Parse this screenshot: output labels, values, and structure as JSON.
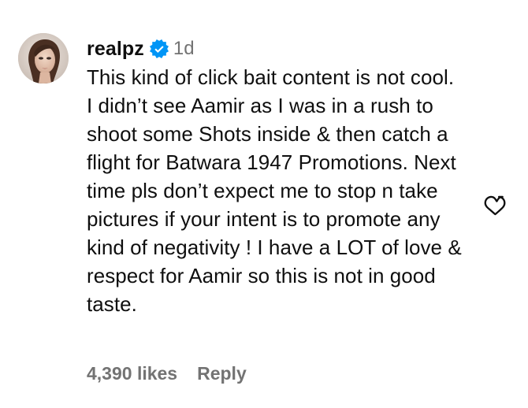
{
  "comment": {
    "username": "realpz",
    "verified": true,
    "timestamp": "1d",
    "text": "This kind of click bait content is not cool. I didn’t see Aamir as I was in a rush to shoot some Shots inside & then catch a flight for Batwara 1947 Promotions. Next time pls don’t expect me to stop n take pictures if your intent is to promote any kind of negativity ! I have a LOT of love & respect for Aamir so this is not in good taste.",
    "likes": "4,390 likes",
    "reply_label": "Reply"
  },
  "icons": {
    "verified": "verified-badge-icon",
    "like": "heart-outline-icon"
  },
  "colors": {
    "text_primary": "#0f0f0f",
    "text_secondary": "#737373",
    "verified_blue": "#0095f6",
    "background": "#ffffff"
  }
}
